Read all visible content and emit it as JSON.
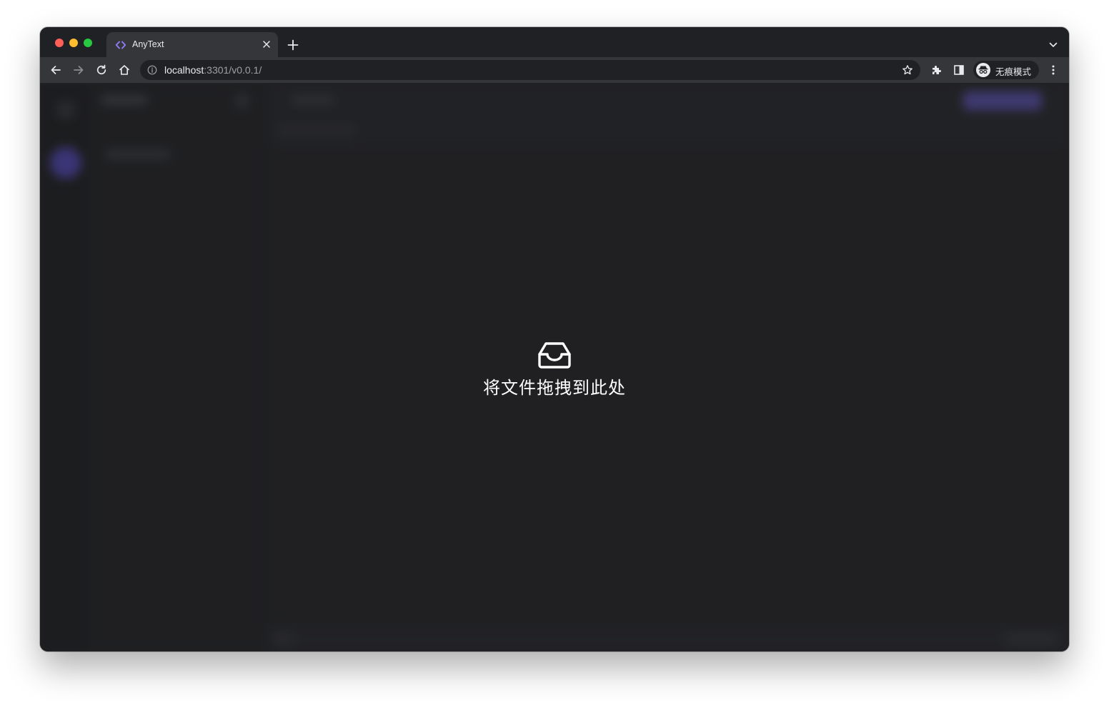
{
  "browser": {
    "tab": {
      "title": "AnyText",
      "favicon": "code-brackets-icon",
      "favicon_color": "#8b7cf6"
    },
    "address": {
      "host": "localhost",
      "path": ":3301/v0.0.1/"
    },
    "profile": {
      "label": "无痕模式",
      "icon": "incognito-icon"
    },
    "icons": [
      "back-icon",
      "forward-icon",
      "reload-icon",
      "home-icon",
      "info-icon",
      "star-icon",
      "extensions-icon",
      "side-panel-icon",
      "menu-dots-icon",
      "new-tab-icon",
      "tab-close-icon",
      "tab-search-icon"
    ]
  },
  "page": {
    "drop_zone": {
      "icon": "inbox-icon",
      "text": "将文件拖拽到此处"
    },
    "accent": "#6a60e0"
  }
}
